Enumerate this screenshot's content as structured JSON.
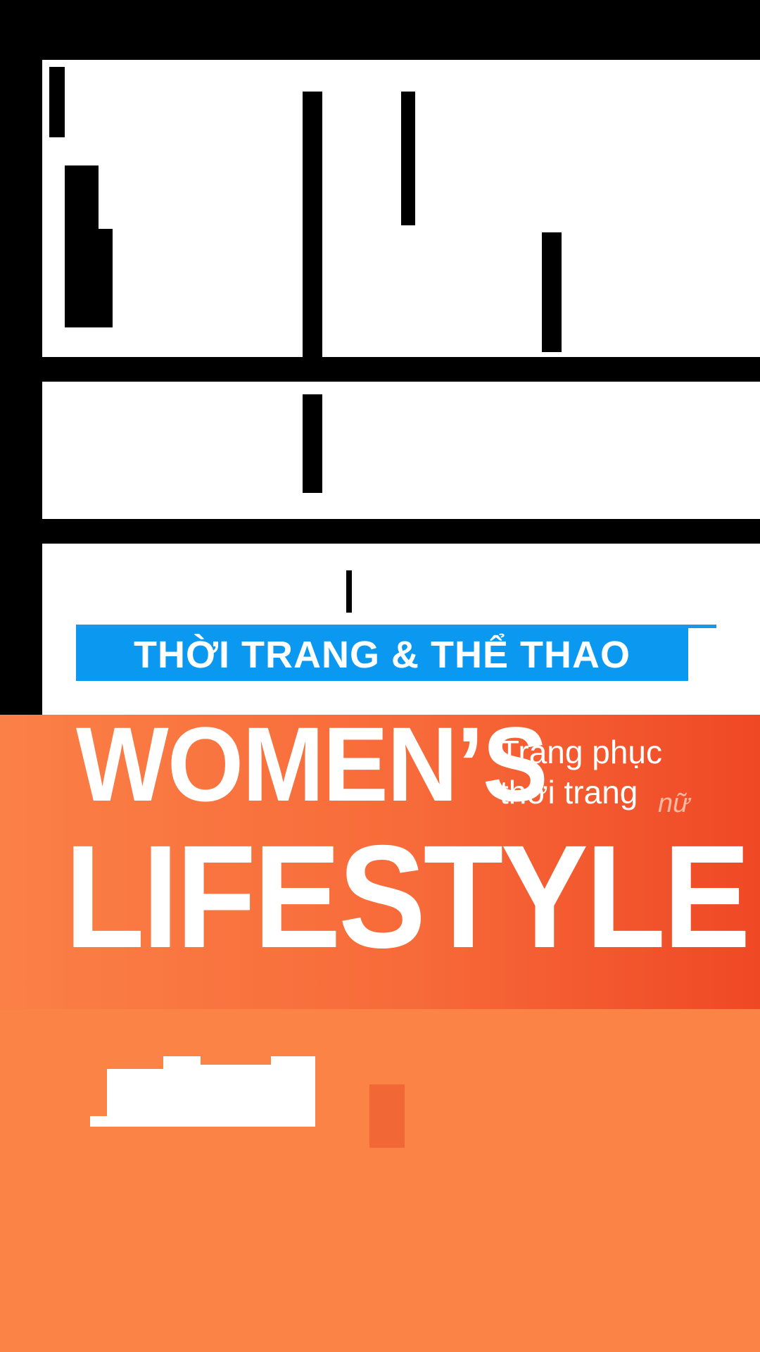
{
  "banner": {
    "text": "THỜI TRANG & THỂ THAO"
  },
  "headline": {
    "line1": "WOMEN’S",
    "line2": "LIFESTYLE"
  },
  "subtitle": {
    "line1": "Trang phục",
    "line2": "thời trang",
    "accent": "nữ"
  },
  "colors": {
    "background": "#000000",
    "white": "#ffffff",
    "banner_blue": "#0a98f0",
    "orange_light": "#fb8047",
    "orange_mid": "#f76a39",
    "orange_dark": "#ef4825",
    "orange_flat": "#fb8346",
    "red_accent": "#f16836",
    "accent_pink": "#f9b8a0"
  }
}
